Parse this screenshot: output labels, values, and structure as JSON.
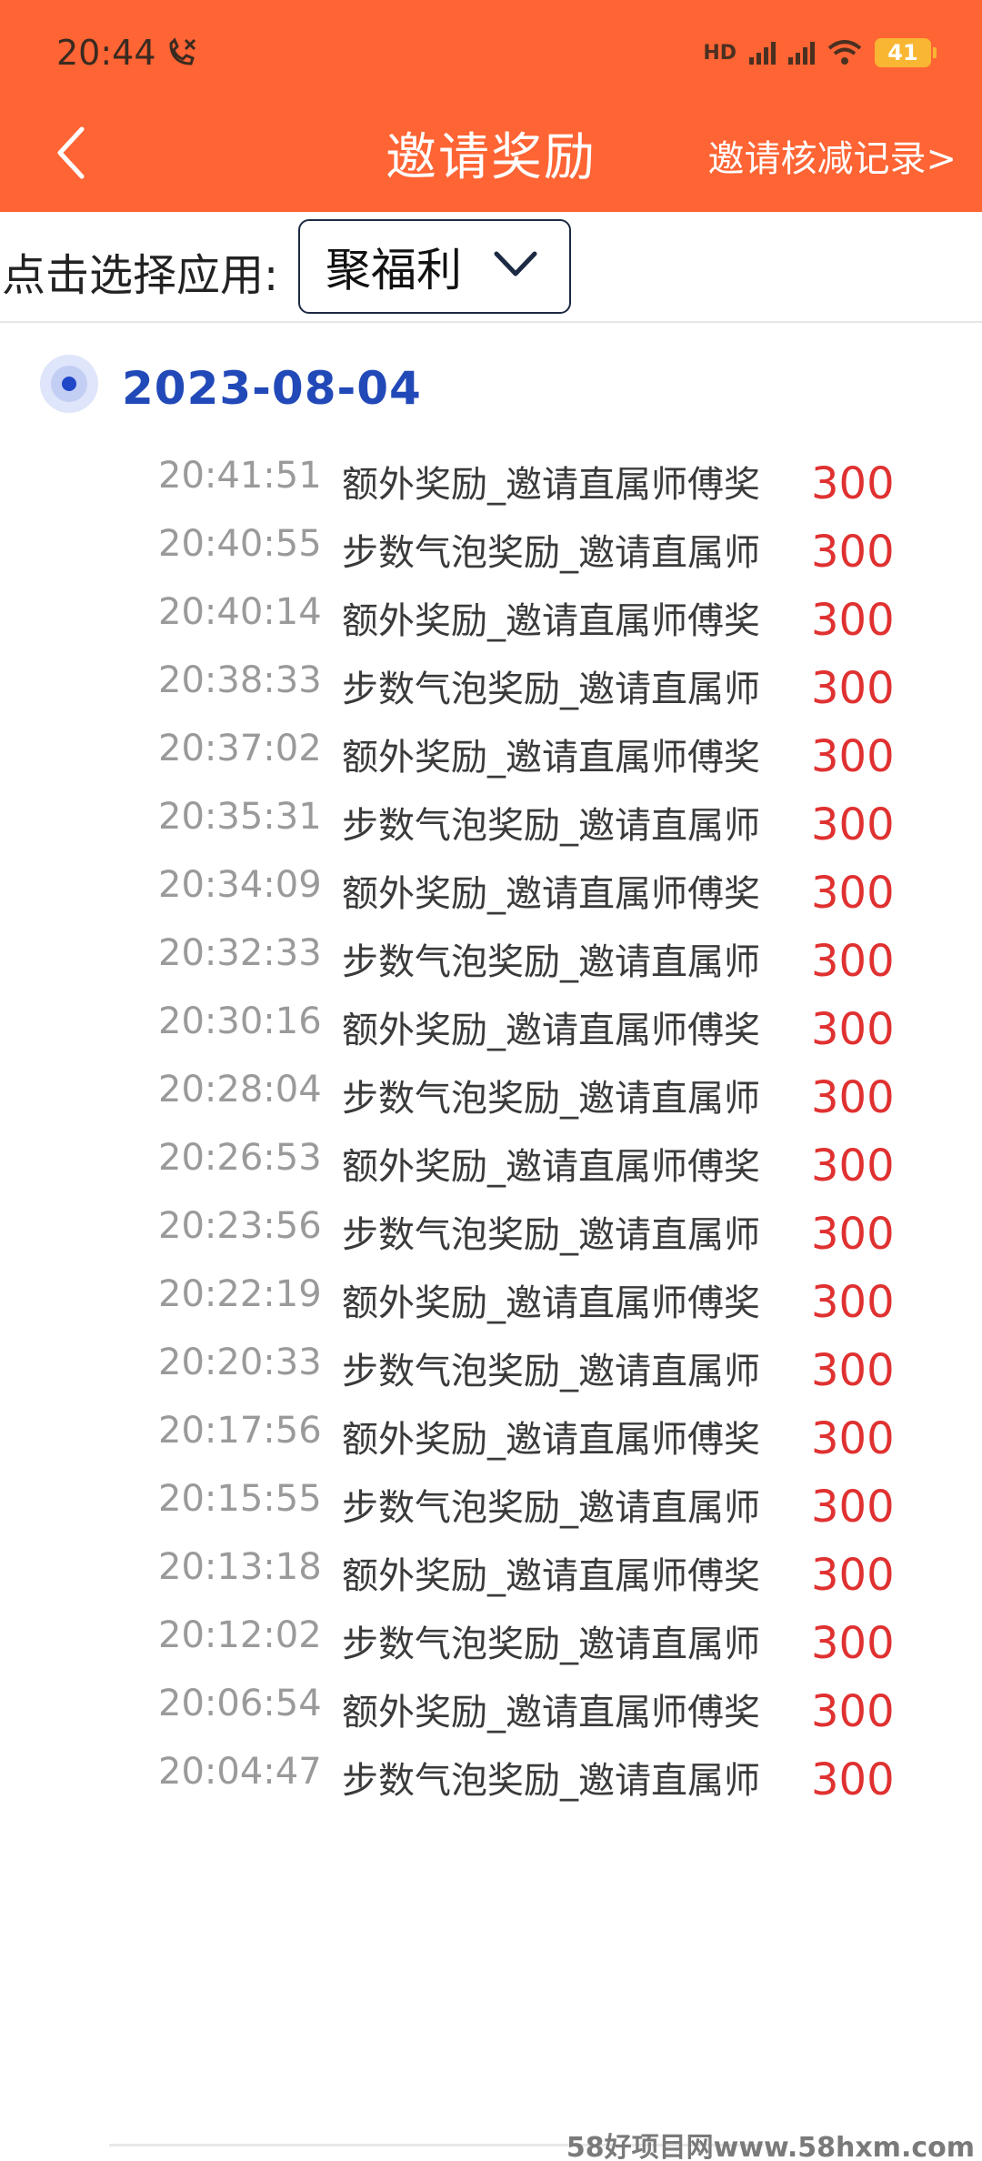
{
  "status_bar": {
    "time": "20:44",
    "battery": "41"
  },
  "header": {
    "title": "邀请奖励",
    "record_link": "邀请核减记录>"
  },
  "selector": {
    "label": "点击选择应用:",
    "value": "聚福利"
  },
  "date": "2023-08-04",
  "records": [
    {
      "time": "20:41:51",
      "desc": "额外奖励_邀请直属师傅奖",
      "amount": "300"
    },
    {
      "time": "20:40:55",
      "desc": "步数气泡奖励_邀请直属师",
      "amount": "300"
    },
    {
      "time": "20:40:14",
      "desc": "额外奖励_邀请直属师傅奖",
      "amount": "300"
    },
    {
      "time": "20:38:33",
      "desc": "步数气泡奖励_邀请直属师",
      "amount": "300"
    },
    {
      "time": "20:37:02",
      "desc": "额外奖励_邀请直属师傅奖",
      "amount": "300"
    },
    {
      "time": "20:35:31",
      "desc": "步数气泡奖励_邀请直属师",
      "amount": "300"
    },
    {
      "time": "20:34:09",
      "desc": "额外奖励_邀请直属师傅奖",
      "amount": "300"
    },
    {
      "time": "20:32:33",
      "desc": "步数气泡奖励_邀请直属师",
      "amount": "300"
    },
    {
      "time": "20:30:16",
      "desc": "额外奖励_邀请直属师傅奖",
      "amount": "300"
    },
    {
      "time": "20:28:04",
      "desc": "步数气泡奖励_邀请直属师",
      "amount": "300"
    },
    {
      "time": "20:26:53",
      "desc": "额外奖励_邀请直属师傅奖",
      "amount": "300"
    },
    {
      "time": "20:23:56",
      "desc": "步数气泡奖励_邀请直属师",
      "amount": "300"
    },
    {
      "time": "20:22:19",
      "desc": "额外奖励_邀请直属师傅奖",
      "amount": "300"
    },
    {
      "time": "20:20:33",
      "desc": "步数气泡奖励_邀请直属师",
      "amount": "300"
    },
    {
      "time": "20:17:56",
      "desc": "额外奖励_邀请直属师傅奖",
      "amount": "300"
    },
    {
      "time": "20:15:55",
      "desc": "步数气泡奖励_邀请直属师",
      "amount": "300"
    },
    {
      "time": "20:13:18",
      "desc": "额外奖励_邀请直属师傅奖",
      "amount": "300"
    },
    {
      "time": "20:12:02",
      "desc": "步数气泡奖励_邀请直属师",
      "amount": "300"
    },
    {
      "time": "20:06:54",
      "desc": "额外奖励_邀请直属师傅奖",
      "amount": "300"
    },
    {
      "time": "20:04:47",
      "desc": "步数气泡奖励_邀请直属师",
      "amount": "300"
    }
  ],
  "watermark": "58好项目网www.58hxm.com"
}
